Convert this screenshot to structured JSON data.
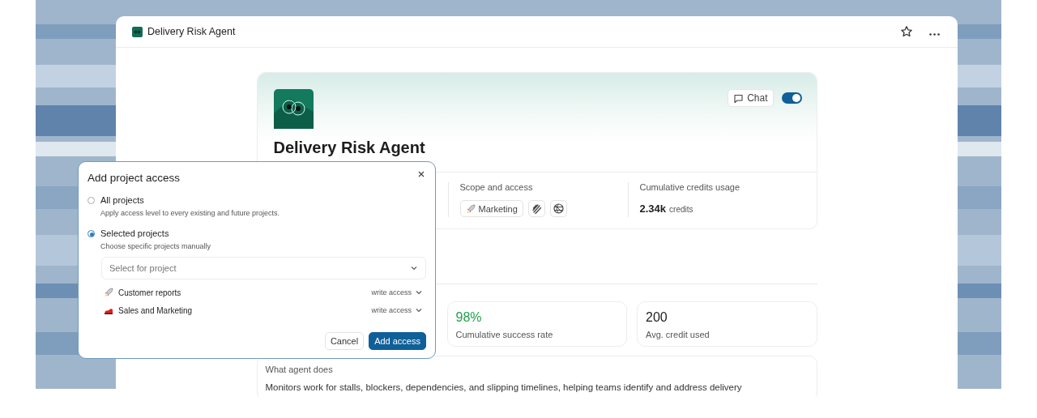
{
  "window": {
    "title": "Delivery Risk Agent"
  },
  "agent": {
    "name": "Delivery Risk Agent",
    "chat_label": "Chat",
    "chat_enabled": true,
    "scope": {
      "label": "Scope and access",
      "project": "Marketing"
    },
    "credits": {
      "label": "Cumulative credits usage",
      "value": "2.34k",
      "unit": "credits"
    }
  },
  "metrics": [
    {
      "value": "98%",
      "label": "Cumulative success rate",
      "color": "#21a24a"
    },
    {
      "value": "200",
      "label": "Avg. credit used",
      "color": "#1d1d1f"
    }
  ],
  "description": {
    "label": "What agent does",
    "text": "Monitors work for stalls, blockers, dependencies, and slipping timelines, helping teams identify and address delivery"
  },
  "dialog": {
    "title": "Add project access",
    "options": [
      {
        "label": "All projects",
        "hint": "Apply access level to every existing and future projects.",
        "selected": false
      },
      {
        "label": "Selected projects",
        "hint": "Choose specific projects manually",
        "selected": true
      }
    ],
    "select_placeholder": "Select for project",
    "projects": [
      {
        "name": "Customer reports",
        "access": "write access"
      },
      {
        "name": "Sales and Marketing",
        "access": "write access"
      }
    ],
    "buttons": {
      "cancel": "Cancel",
      "confirm": "Add access"
    }
  }
}
